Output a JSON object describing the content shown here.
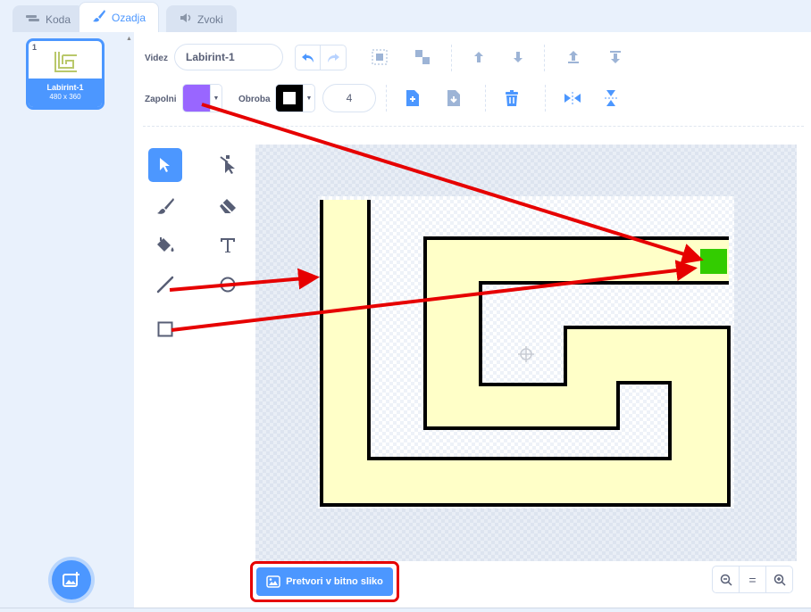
{
  "tabs": [
    {
      "label": "Koda",
      "icon": "code-icon"
    },
    {
      "label": "Ozadja",
      "icon": "paintbrush-icon"
    },
    {
      "label": "Zvoki",
      "icon": "speaker-icon"
    }
  ],
  "costumes": [
    {
      "number": "1",
      "name": "Labirint-1",
      "size": "480 x 360"
    }
  ],
  "toolbar": {
    "name_label": "Videz",
    "name_value": "Labirint-1",
    "fill_label": "Zapolni",
    "fill_color": "#9966ff",
    "outline_label": "Obroba",
    "outline_color": "#000000",
    "outline_width": "4"
  },
  "tools": [
    "select-tool",
    "reshape-tool",
    "brush-tool",
    "eraser-tool",
    "fill-tool",
    "text-tool",
    "line-tool",
    "circle-tool",
    "rectangle-tool"
  ],
  "convert_button": {
    "label": "Pretvori v bitno sliko"
  },
  "zoom": {
    "reset_label": "="
  },
  "colors": {
    "accent": "#4c97ff",
    "maze_fill": "#ffffc8",
    "goal": "#33cc00",
    "annotation": "#e60000"
  }
}
